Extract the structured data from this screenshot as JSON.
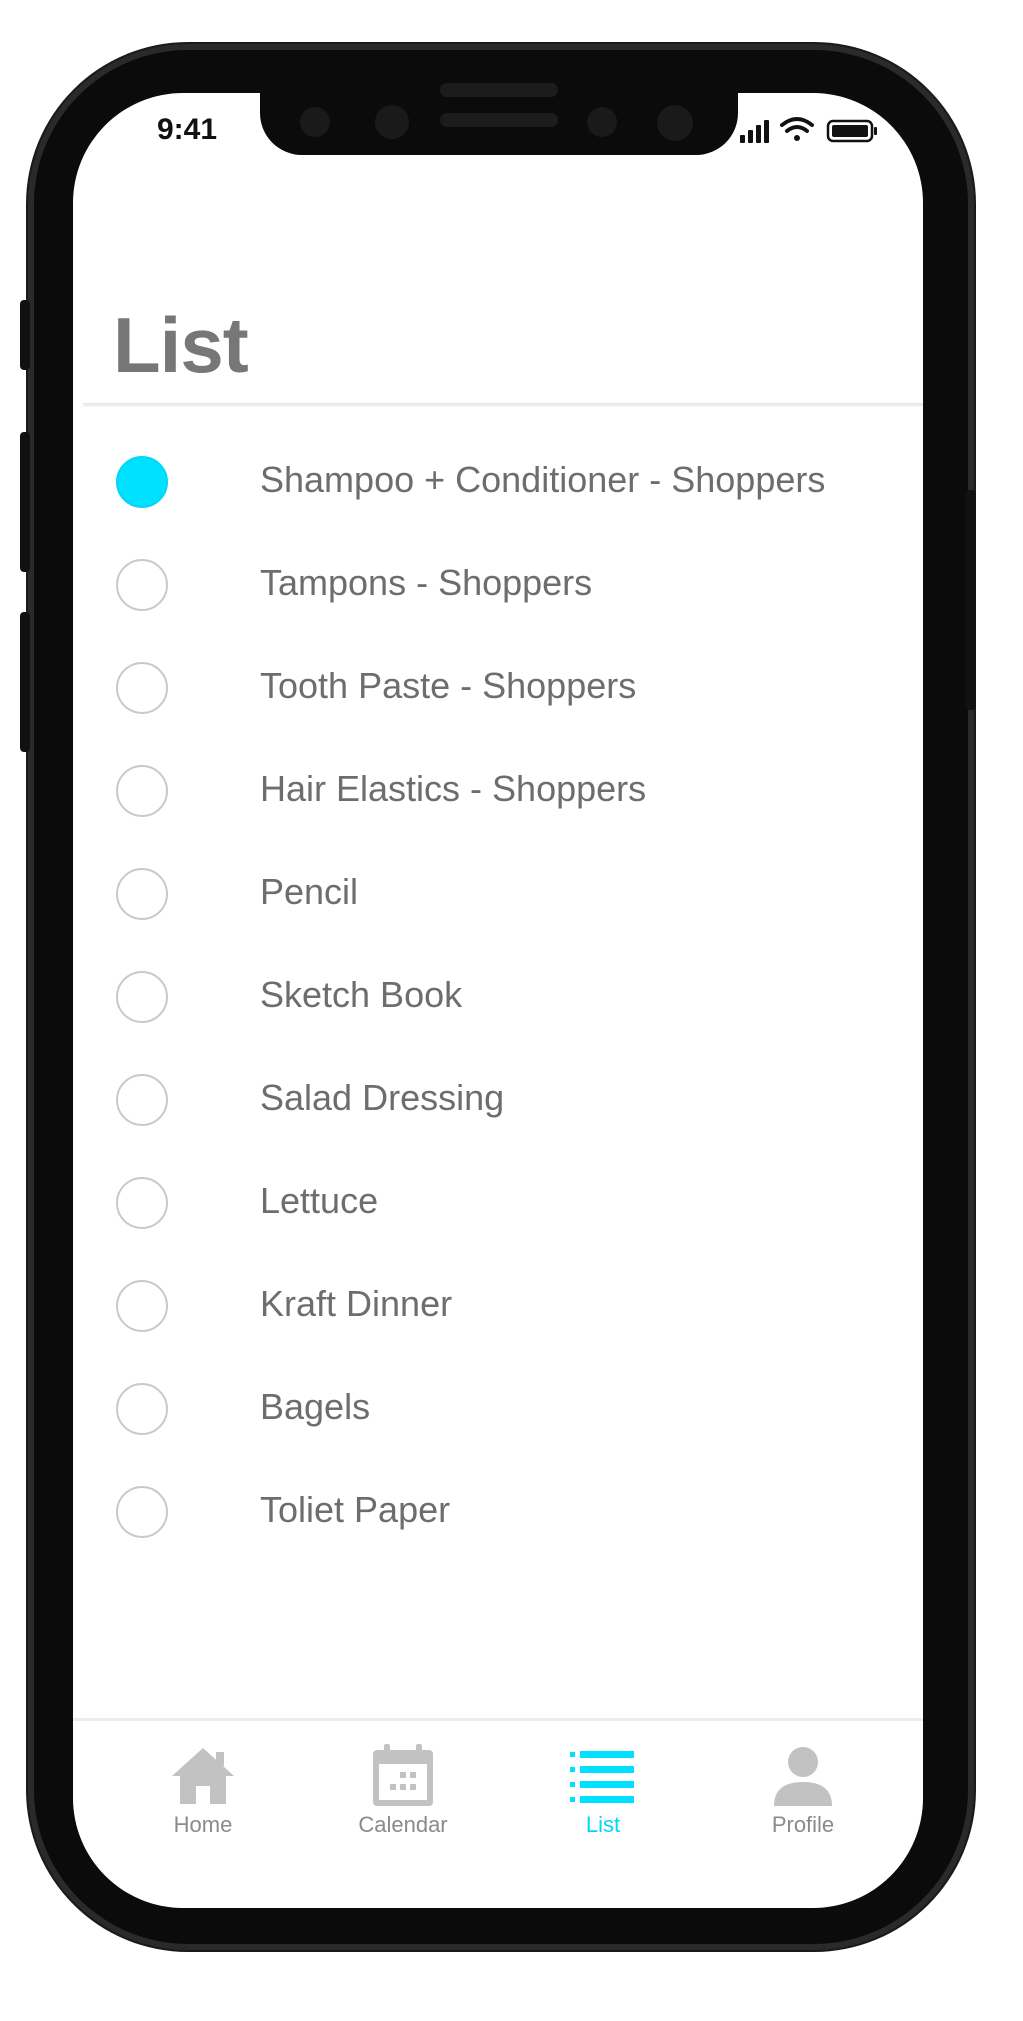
{
  "status_bar": {
    "time": "9:41"
  },
  "header": {
    "title": "List"
  },
  "items": [
    {
      "label": "Shampoo + Conditioner - Shoppers",
      "checked": true
    },
    {
      "label": "Tampons - Shoppers",
      "checked": false
    },
    {
      "label": "Tooth Paste - Shoppers",
      "checked": false
    },
    {
      "label": "Hair Elastics - Shoppers",
      "checked": false
    },
    {
      "label": "Pencil",
      "checked": false
    },
    {
      "label": "Sketch Book",
      "checked": false
    },
    {
      "label": "Salad Dressing",
      "checked": false
    },
    {
      "label": "Lettuce",
      "checked": false
    },
    {
      "label": "Kraft Dinner",
      "checked": false
    },
    {
      "label": "Bagels",
      "checked": false
    },
    {
      "label": "Toliet Paper",
      "checked": false
    }
  ],
  "nav": {
    "tabs": [
      {
        "label": "Home",
        "icon": "home-icon",
        "active": false
      },
      {
        "label": "Calendar",
        "icon": "calendar-icon",
        "active": false
      },
      {
        "label": "List",
        "icon": "list-icon",
        "active": true
      },
      {
        "label": "Profile",
        "icon": "profile-icon",
        "active": false
      }
    ]
  },
  "colors": {
    "accent": "#00e0ff",
    "text": "#6d6d6d",
    "title": "#777777",
    "inactive_nav": "#c2c2c2"
  }
}
